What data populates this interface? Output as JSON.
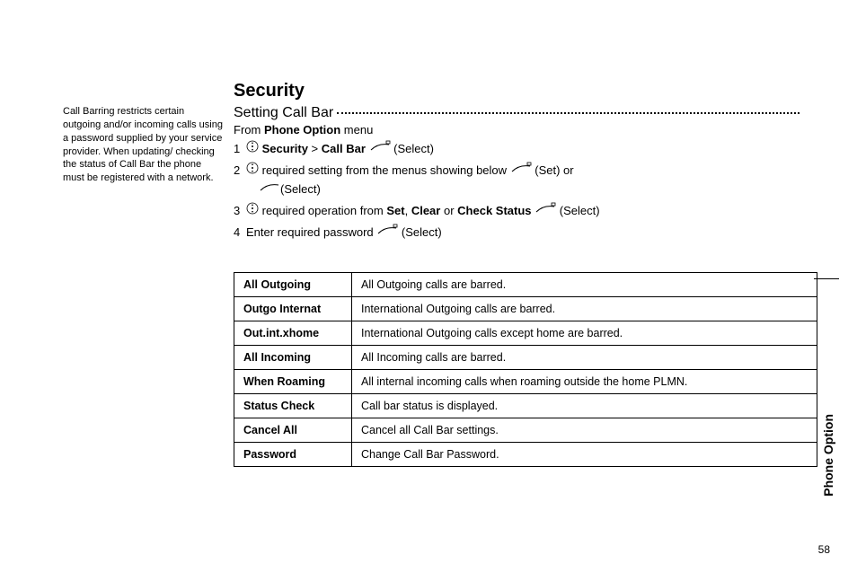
{
  "heading": "Security",
  "subheading": "Setting Call Bar",
  "sidenote": "Call Barring restricts certain outgoing and/or incoming calls using a password supplied by your service provider. When updating/ checking the status of Call Bar the phone must be registered with a network.",
  "from_prefix": "From ",
  "from_bold": "Phone Option",
  "from_suffix": " menu",
  "steps": {
    "s1": {
      "num": "1",
      "b1": "Security",
      "gt": " > ",
      "b2": "Call Bar",
      "tail": " (Select)"
    },
    "s2": {
      "num": "2",
      "lead": " required setting from the menus showing below ",
      "set": " (Set) or",
      "sel": "(Select)"
    },
    "s3": {
      "num": "3",
      "lead": " required operation from ",
      "b1": "Set",
      "c1": ", ",
      "b2": "Clear",
      "c2": " or ",
      "b3": "Check Status",
      "tail": " (Select)"
    },
    "s4": {
      "num": "4",
      "text": "Enter required password ",
      "tail": " (Select)"
    }
  },
  "table": [
    {
      "k": "All Outgoing",
      "v": "All Outgoing calls are barred."
    },
    {
      "k": "Outgo Internat",
      "v": "International Outgoing calls are barred."
    },
    {
      "k": "Out.int.xhome",
      "v": "International Outgoing calls except home are barred."
    },
    {
      "k": "All Incoming",
      "v": "All Incoming calls are barred."
    },
    {
      "k": "When Roaming",
      "v": "All internal incoming calls when roaming outside the home PLMN."
    },
    {
      "k": "Status Check",
      "v": "Call bar status is displayed."
    },
    {
      "k": "Cancel All",
      "v": "Cancel all Call Bar settings."
    },
    {
      "k": "Password",
      "v": "Change Call Bar Password."
    }
  ],
  "side_tab": "Phone Option",
  "page_number": "58"
}
